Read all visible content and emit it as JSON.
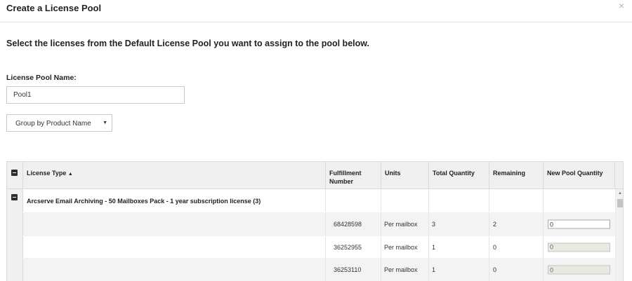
{
  "dialog": {
    "title": "Create a License Pool",
    "close_glyph": "×"
  },
  "instructions": "Select the licenses from the Default License Pool you want to assign to the pool below.",
  "pool_name": {
    "label": "License Pool Name:",
    "value": "Pool1"
  },
  "group_by": {
    "selected": "Group by Product Name",
    "caret": "▼"
  },
  "grid": {
    "columns": [
      {
        "key": "license_type",
        "label": "License Type",
        "sort": "▲"
      },
      {
        "key": "fulfillment",
        "label": "Fulfillment Number"
      },
      {
        "key": "units",
        "label": "Units"
      },
      {
        "key": "total",
        "label": "Total Quantity"
      },
      {
        "key": "remaining",
        "label": "Remaining"
      },
      {
        "key": "new_qty",
        "label": "New Pool Quantity"
      }
    ],
    "group": {
      "title": "Arcserve Email Archiving - 50 Mailboxes Pack - 1 year subscription license (3)"
    },
    "rows": [
      {
        "fulfillment": "68428598",
        "units": "Per mailbox",
        "total": "3",
        "remaining": "2",
        "new_qty": "0",
        "editable": true
      },
      {
        "fulfillment": "36252955",
        "units": "Per mailbox",
        "total": "1",
        "remaining": "0",
        "new_qty": "0",
        "editable": false
      },
      {
        "fulfillment": "36253110",
        "units": "Per mailbox",
        "total": "1",
        "remaining": "0",
        "new_qty": "0",
        "editable": false
      }
    ]
  },
  "icons": {
    "collapse_all": "minus-square-icon",
    "collapse_group": "minus-square-icon",
    "scroll_up": "▲"
  }
}
